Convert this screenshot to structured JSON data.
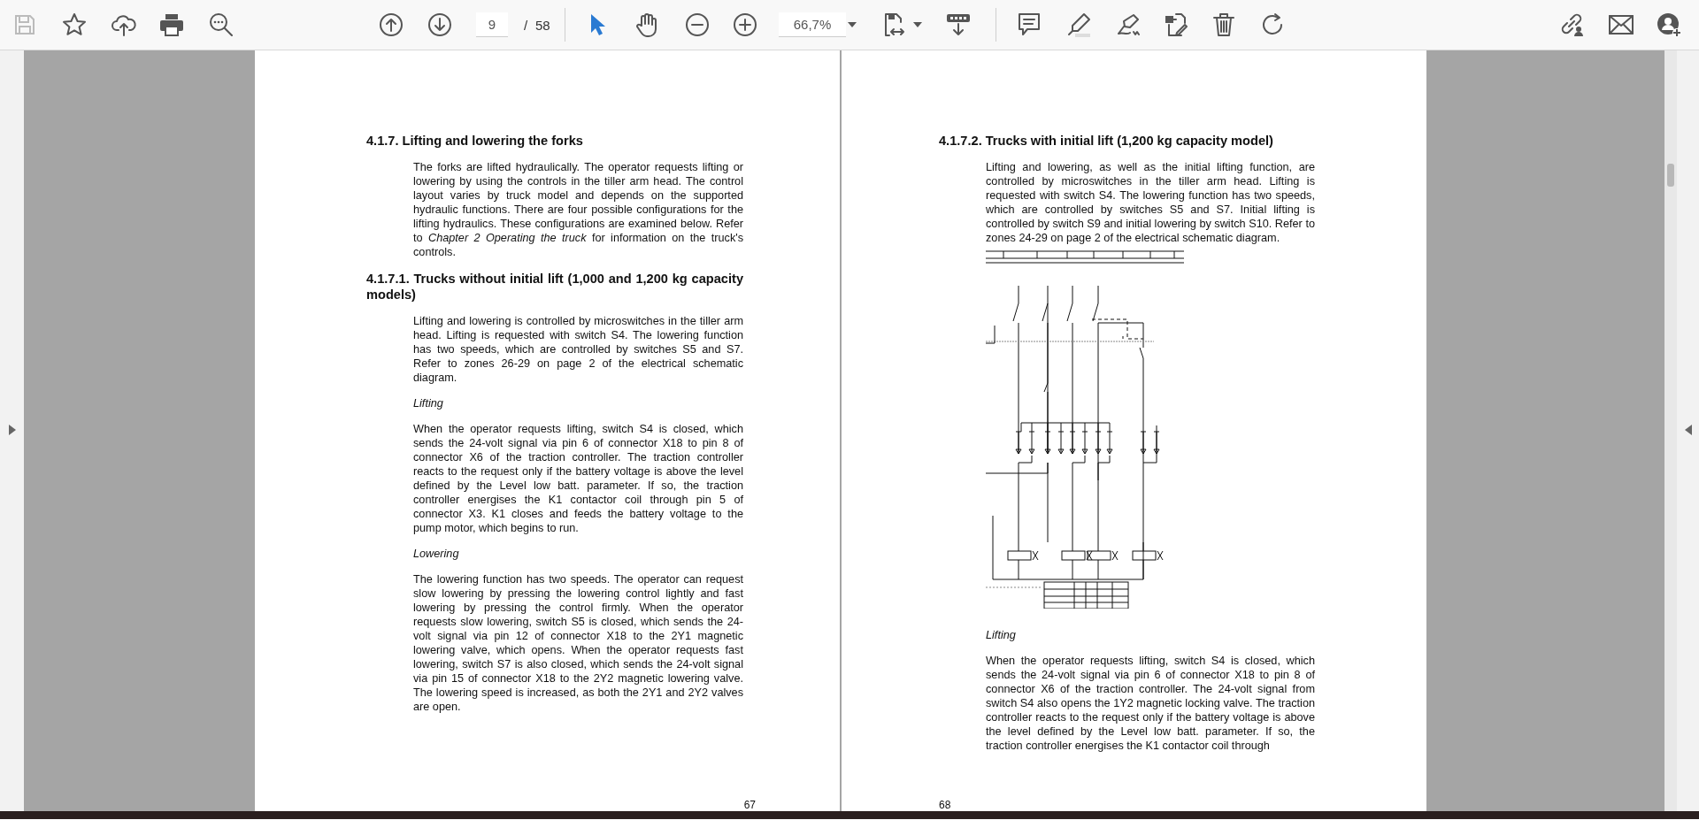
{
  "toolbar": {
    "save_disabled": true,
    "tools": [
      {
        "kind": "select",
        "selected": true
      },
      {
        "kind": "hand",
        "selected": false
      }
    ],
    "page_number": "9",
    "page_separator": "/",
    "page_count": "58",
    "zoom": "66,7%"
  },
  "pages": [
    {
      "blocks": [
        {
          "kind": "heading",
          "text": "4.1.7. Lifting and lowering the forks"
        },
        {
          "kind": "para",
          "text": "The forks are lifted hydraulically. The operator requests lifting or lowering by using the controls in the tiller arm head. The control layout varies by truck model and depends on the supported hydraulic functions. There are four possible configurations for the lifting hydraulics. These configurations are examined below. Refer to *Chapter 2 Operating the truck* for information on the truck's controls."
        },
        {
          "kind": "heading",
          "text": "4.1.7.1. Trucks without initial lift (1,000 and 1,200 kg capacity models)"
        },
        {
          "kind": "para",
          "text": "Lifting and lowering is controlled by microswitches in the tiller arm head. Lifting is requested with switch S4. The lowering function has two speeds, which are controlled by switches S5 and S7. Refer to zones 26-29 on page 2 of the electrical schematic diagram."
        },
        {
          "kind": "caption",
          "text": "Lifting"
        },
        {
          "kind": "para",
          "text": "When the operator requests lifting, switch S4 is closed, which sends the 24-volt signal via pin 6 of connector X18 to pin 8 of connector X6 of the traction controller. The traction controller reacts to the request only if the battery voltage is above the level defined by the Level low batt. parameter. If so, the traction controller energises the K1 contactor coil through pin 5 of connector X3. K1 closes and feeds the battery voltage to the pump motor, which begins to run."
        },
        {
          "kind": "caption",
          "text": "Lowering"
        },
        {
          "kind": "para",
          "text": "The lowering function has two speeds. The operator can request slow lowering by pressing the lowering control lightly and fast lowering by pressing the control firmly. When the operator requests slow lowering, switch S5 is closed, which sends the 24-volt signal via pin 12 of connector X18 to the 2Y1 magnetic lowering valve, which opens. When the operator requests fast lowering, switch S7 is also closed, which sends the 24-volt signal via pin 15 of connector X18 to the 2Y2 magnetic lowering valve. The lowering speed is increased, as both the 2Y1 and 2Y2 valves are open."
        }
      ],
      "page_number": "67"
    },
    {
      "blocks": [
        {
          "kind": "heading",
          "text": "4.1.7.2. Trucks with initial lift (1,200 kg capacity model)"
        },
        {
          "kind": "para",
          "text": "Lifting and lowering, as well as the initial lifting function, are controlled by microswitches in the tiller arm head. Lifting is requested with switch S4. The lowering function has two speeds, which are controlled by switches S5 and S7. Initial lifting is controlled by switch S9 and initial lowering by switch S10. Refer to zones 24-29 on page 2 of the electrical schematic diagram."
        },
        {
          "kind": "schematic"
        },
        {
          "kind": "caption",
          "text": "Lifting"
        },
        {
          "kind": "para",
          "text": "When the operator requests lifting, switch S4 is closed, which sends the 24-volt signal via pin 6 of connector X18 to pin 8 of connector X6 of the traction controller. The 24-volt signal from switch S4 also opens the 1Y2 magnetic locking valve. The traction controller reacts to the request only if the battery voltage is above the level defined by the Level low batt. parameter. If so, the traction controller energises the K1 contactor coil through"
        }
      ],
      "page_number": "68"
    }
  ]
}
